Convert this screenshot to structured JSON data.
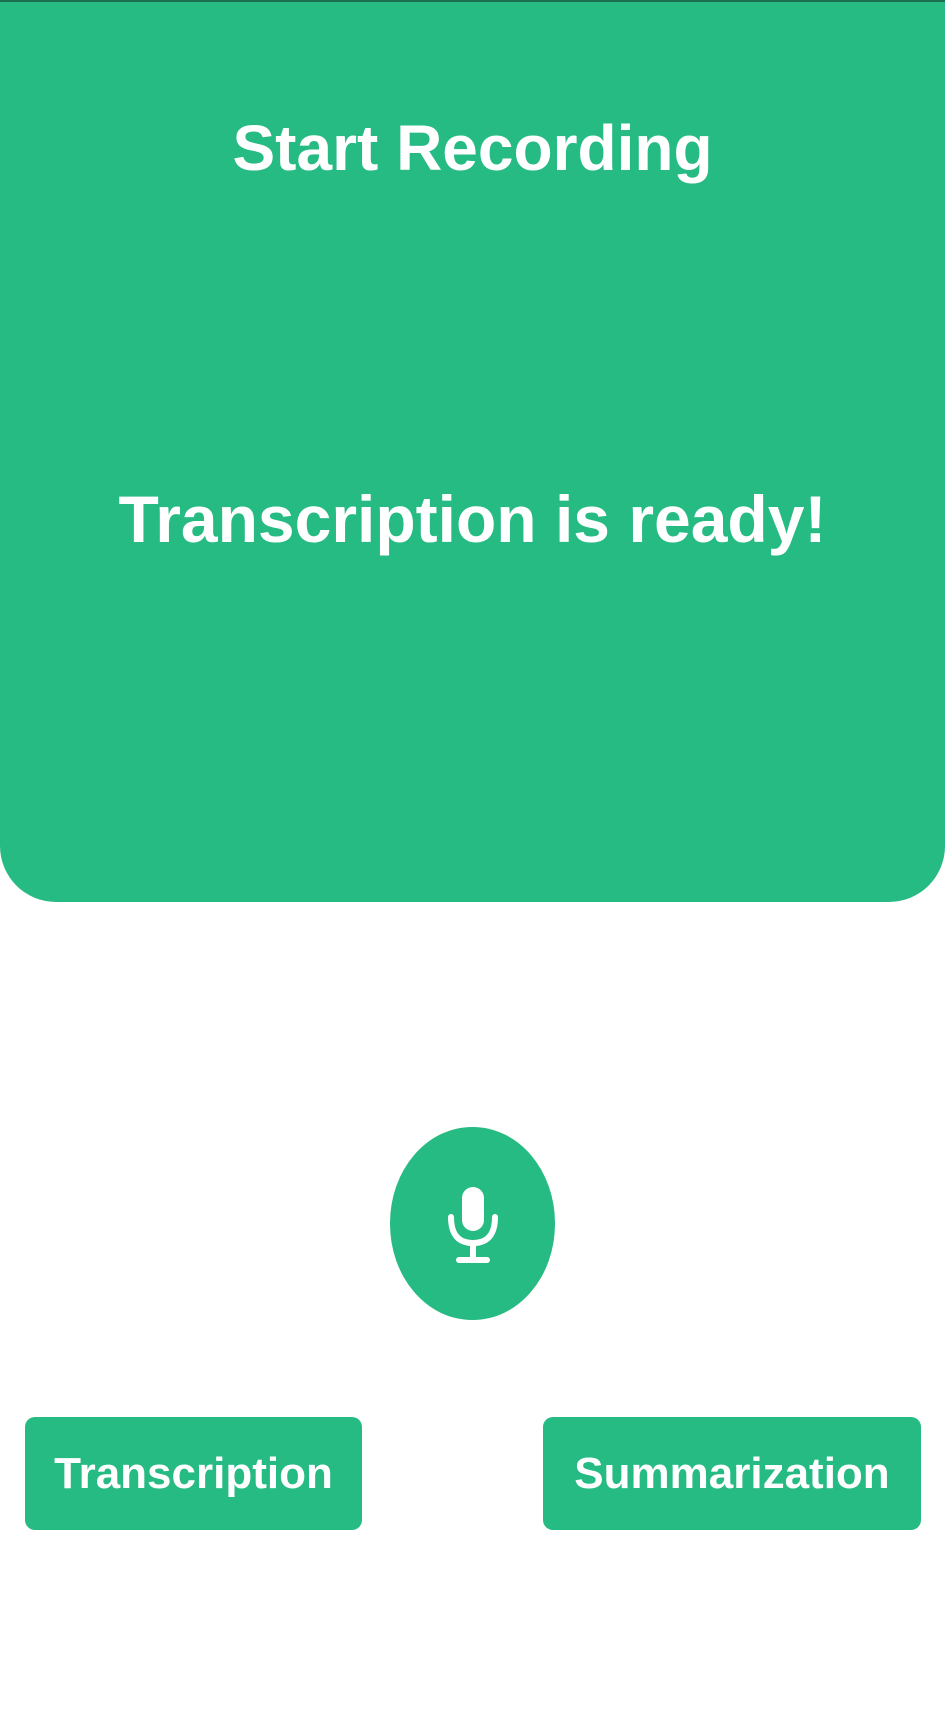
{
  "header": {
    "title": "Start Recording",
    "status_text": "Transcription is ready!"
  },
  "mic_button": {
    "icon": "microphone-icon"
  },
  "actions": {
    "transcription_label": "Transcription",
    "summarization_label": "Summarization"
  },
  "colors": {
    "accent": "#27bb84",
    "text_on_accent": "#ffffff",
    "background": "#ffffff"
  }
}
